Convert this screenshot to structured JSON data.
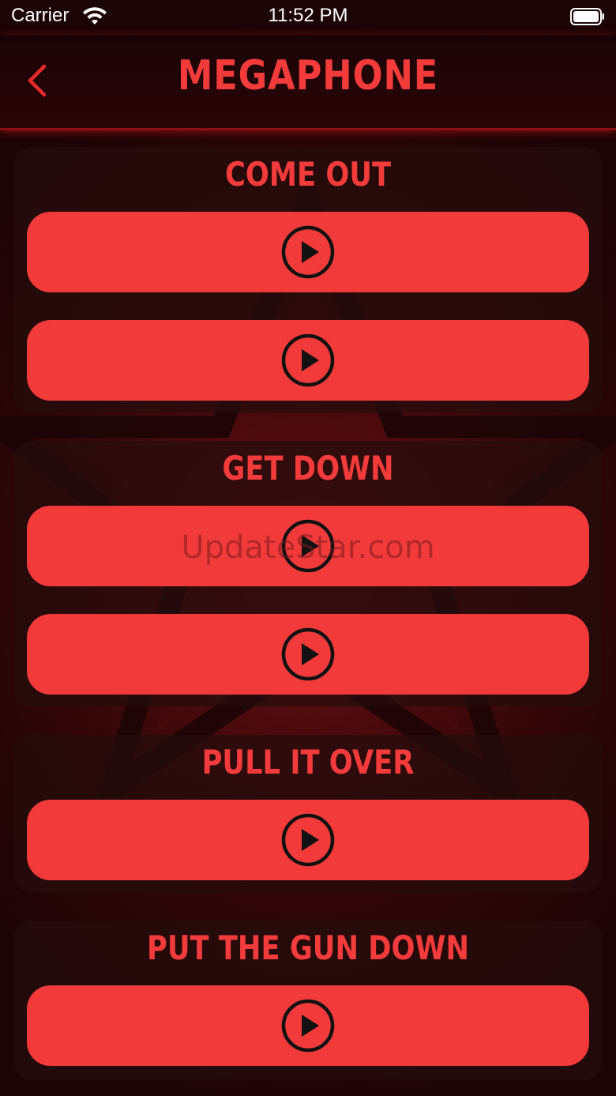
{
  "status_bar": {
    "carrier": "Carrier",
    "time": "11:52 PM"
  },
  "nav": {
    "title": "MEGAPHONE",
    "back_icon": "chevron-left-icon"
  },
  "sections": [
    {
      "title": "COME OUT",
      "buttons": 2
    },
    {
      "title": "GET DOWN",
      "buttons": 2
    },
    {
      "title": "PULL IT OVER",
      "buttons": 1
    },
    {
      "title": "PUT THE GUN DOWN",
      "buttons": 1
    }
  ],
  "watermark": "UpdateStar.com",
  "colors": {
    "accent": "#f33a3a",
    "background": "#2a0608",
    "card": "#260c0d",
    "icon": "#111111"
  }
}
